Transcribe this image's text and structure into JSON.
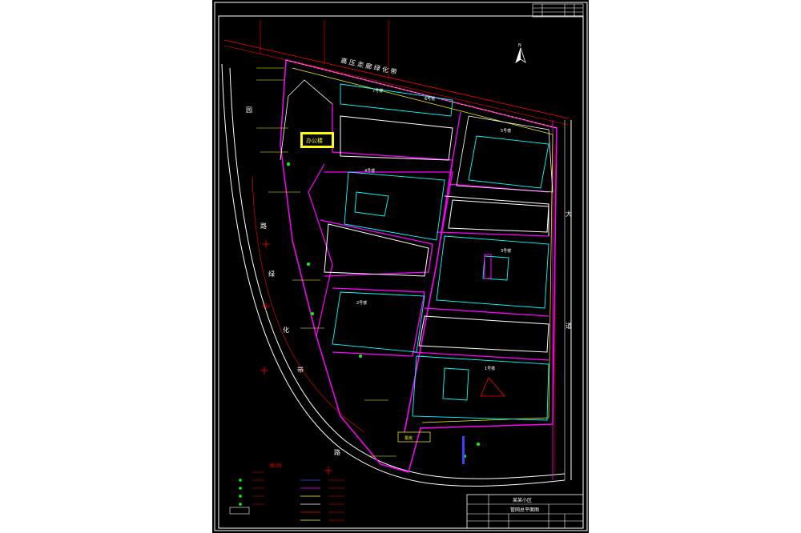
{
  "drawing": {
    "top_road_label": "高 压 走 廊 绿 化 带",
    "left_road_chars": [
      "园",
      "路",
      "绿",
      "化",
      "带",
      "路"
    ],
    "right_road_chars": [
      "大",
      "道"
    ],
    "north_mark": "N",
    "tag_label": "办公楼",
    "legend_title": "图 例",
    "building_labels": {
      "b7": "7号楼",
      "b6": "6号楼",
      "b5": "5号楼",
      "b4": "4号楼",
      "b3": "3号楼",
      "b2": "2号楼",
      "b1": "1号楼"
    },
    "pump_label": "泵房",
    "title_block": {
      "project": "某某小区",
      "drawing_name": "管网总平面图"
    }
  },
  "colors": {
    "sheet_bg": "#000000",
    "frame": "#ffffff",
    "pipe_magenta": "#ff00ff",
    "pipe_yellow": "#ffff00",
    "building_cyan": "#00ffff",
    "red_line": "#ff0000",
    "green_mark": "#00ff00",
    "blue_line": "#4040ff",
    "road_white": "#ffffff"
  }
}
